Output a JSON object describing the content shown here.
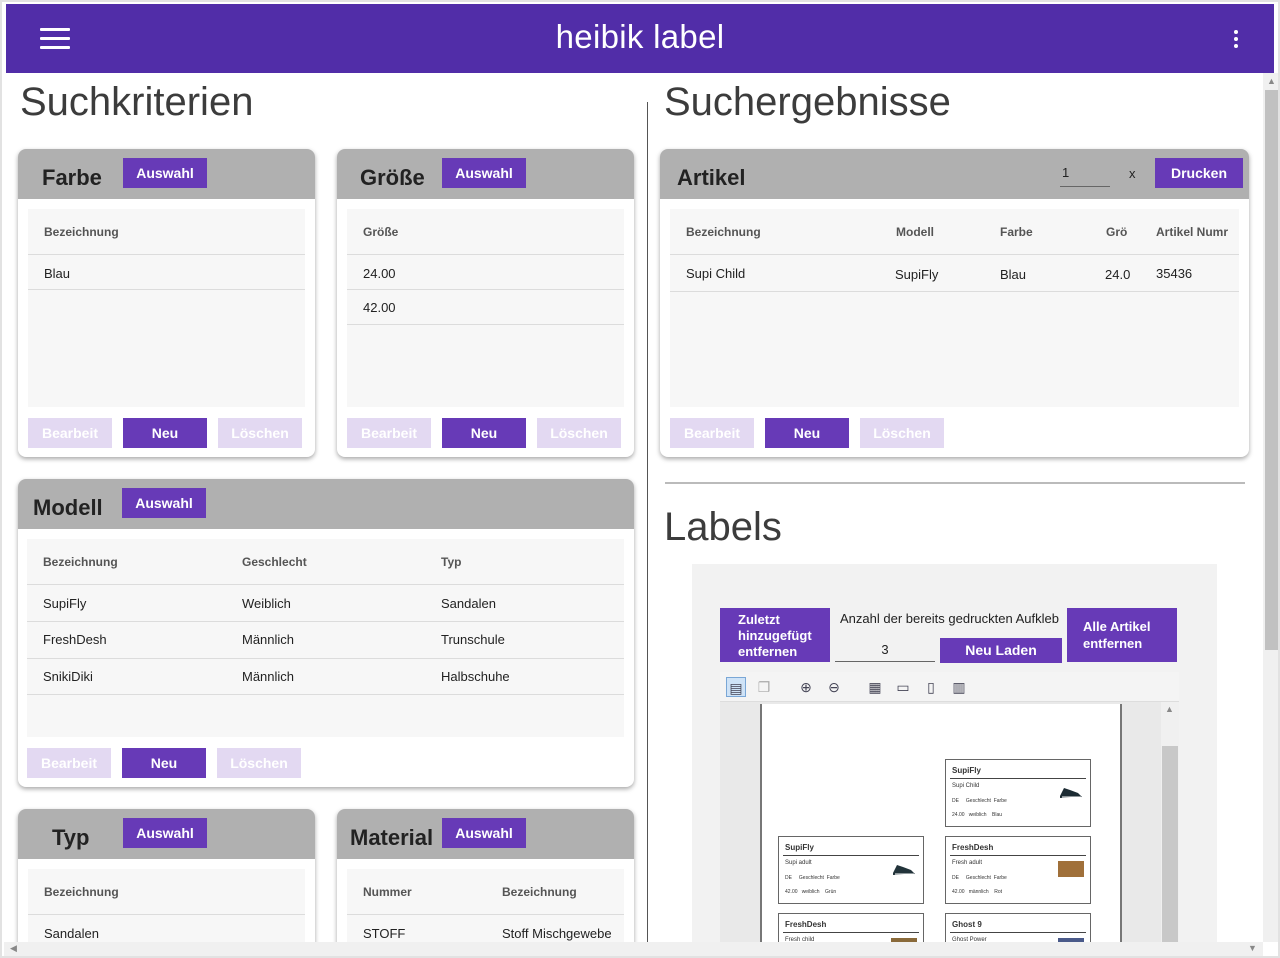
{
  "app": {
    "title": "heibik label"
  },
  "sections": {
    "search": "Suchkriterien",
    "results": "Suchergebnisse",
    "labels": "Labels"
  },
  "buttons": {
    "select": "Auswahl",
    "edit": "Bearbeit",
    "new": "Neu",
    "delete": "Löschen",
    "print": "Drucken"
  },
  "farbe": {
    "title": "Farbe",
    "header": "Bezeichnung",
    "rows": [
      "Blau"
    ]
  },
  "groesse": {
    "title": "Größe",
    "header": "Größe",
    "rows": [
      "24.00",
      "42.00"
    ]
  },
  "modell": {
    "title": "Modell",
    "headers": [
      "Bezeichnung",
      "Geschlecht",
      "Typ"
    ],
    "rows": [
      [
        "SupiFly",
        "Weiblich",
        "Sandalen"
      ],
      [
        "FreshDesh",
        "Männlich",
        "Trunschule"
      ],
      [
        "SnikiDiki",
        "Männlich",
        "Halbschuhe"
      ]
    ]
  },
  "typ": {
    "title": "Typ",
    "header": "Bezeichnung",
    "rows": [
      "Sandalen"
    ]
  },
  "material": {
    "title": "Material",
    "headers": [
      "Nummer",
      "Bezeichnung"
    ],
    "rows": [
      [
        "STOFF",
        "Stoff Mischgewebe"
      ]
    ]
  },
  "artikel": {
    "title": "Artikel",
    "quantity": "1",
    "times": "x",
    "headers": [
      "Bezeichnung",
      "Modell",
      "Farbe",
      "Grö",
      "Artikel Numr"
    ],
    "rows": [
      [
        "Supi Child",
        "SupiFly",
        "Blau",
        "24.0",
        "35436"
      ]
    ]
  },
  "labels_panel": {
    "remove_last": "Zuletzt hinzugefügt entfernen",
    "printed_count_label": "Anzahl der bereits gedruckten Aufkleb",
    "printed_count": "3",
    "reload": "Neu Laden",
    "remove_all": "Alle Artikel entfernen",
    "toolbar_icons": [
      "print-icon",
      "copy-icon",
      "zoom-in-icon",
      "zoom-out-icon",
      "fit-page-icon",
      "fit-width-icon",
      "single-page-icon",
      "two-page-icon"
    ]
  },
  "preview_labels": [
    {
      "title": "SupiFly",
      "sub": "Supi Child",
      "h1": "DE",
      "h2": "Geschlecht",
      "h3": "Farbe",
      "v1": "24.00",
      "v2": "weiblich",
      "v3": "Blau"
    },
    {
      "title": "SupiFly",
      "sub": "Supi adult",
      "h1": "DE",
      "h2": "Geschlecht",
      "h3": "Farbe",
      "v1": "42.00",
      "v2": "weiblich",
      "v3": "Grün"
    },
    {
      "title": "FreshDesh",
      "sub": "Fresh adult",
      "h1": "DE",
      "h2": "Geschlecht",
      "h3": "Farbe",
      "v1": "42.00",
      "v2": "männlich",
      "v3": "Rot"
    },
    {
      "title": "FreshDesh",
      "sub": "Fresh child"
    },
    {
      "title": "Ghost 9",
      "sub": "Ghost Power"
    }
  ],
  "colors": {
    "primary": "#512da8",
    "accent": "#673ab7",
    "disabled": "#e3d9f2",
    "card_header": "#b0b0b0"
  }
}
